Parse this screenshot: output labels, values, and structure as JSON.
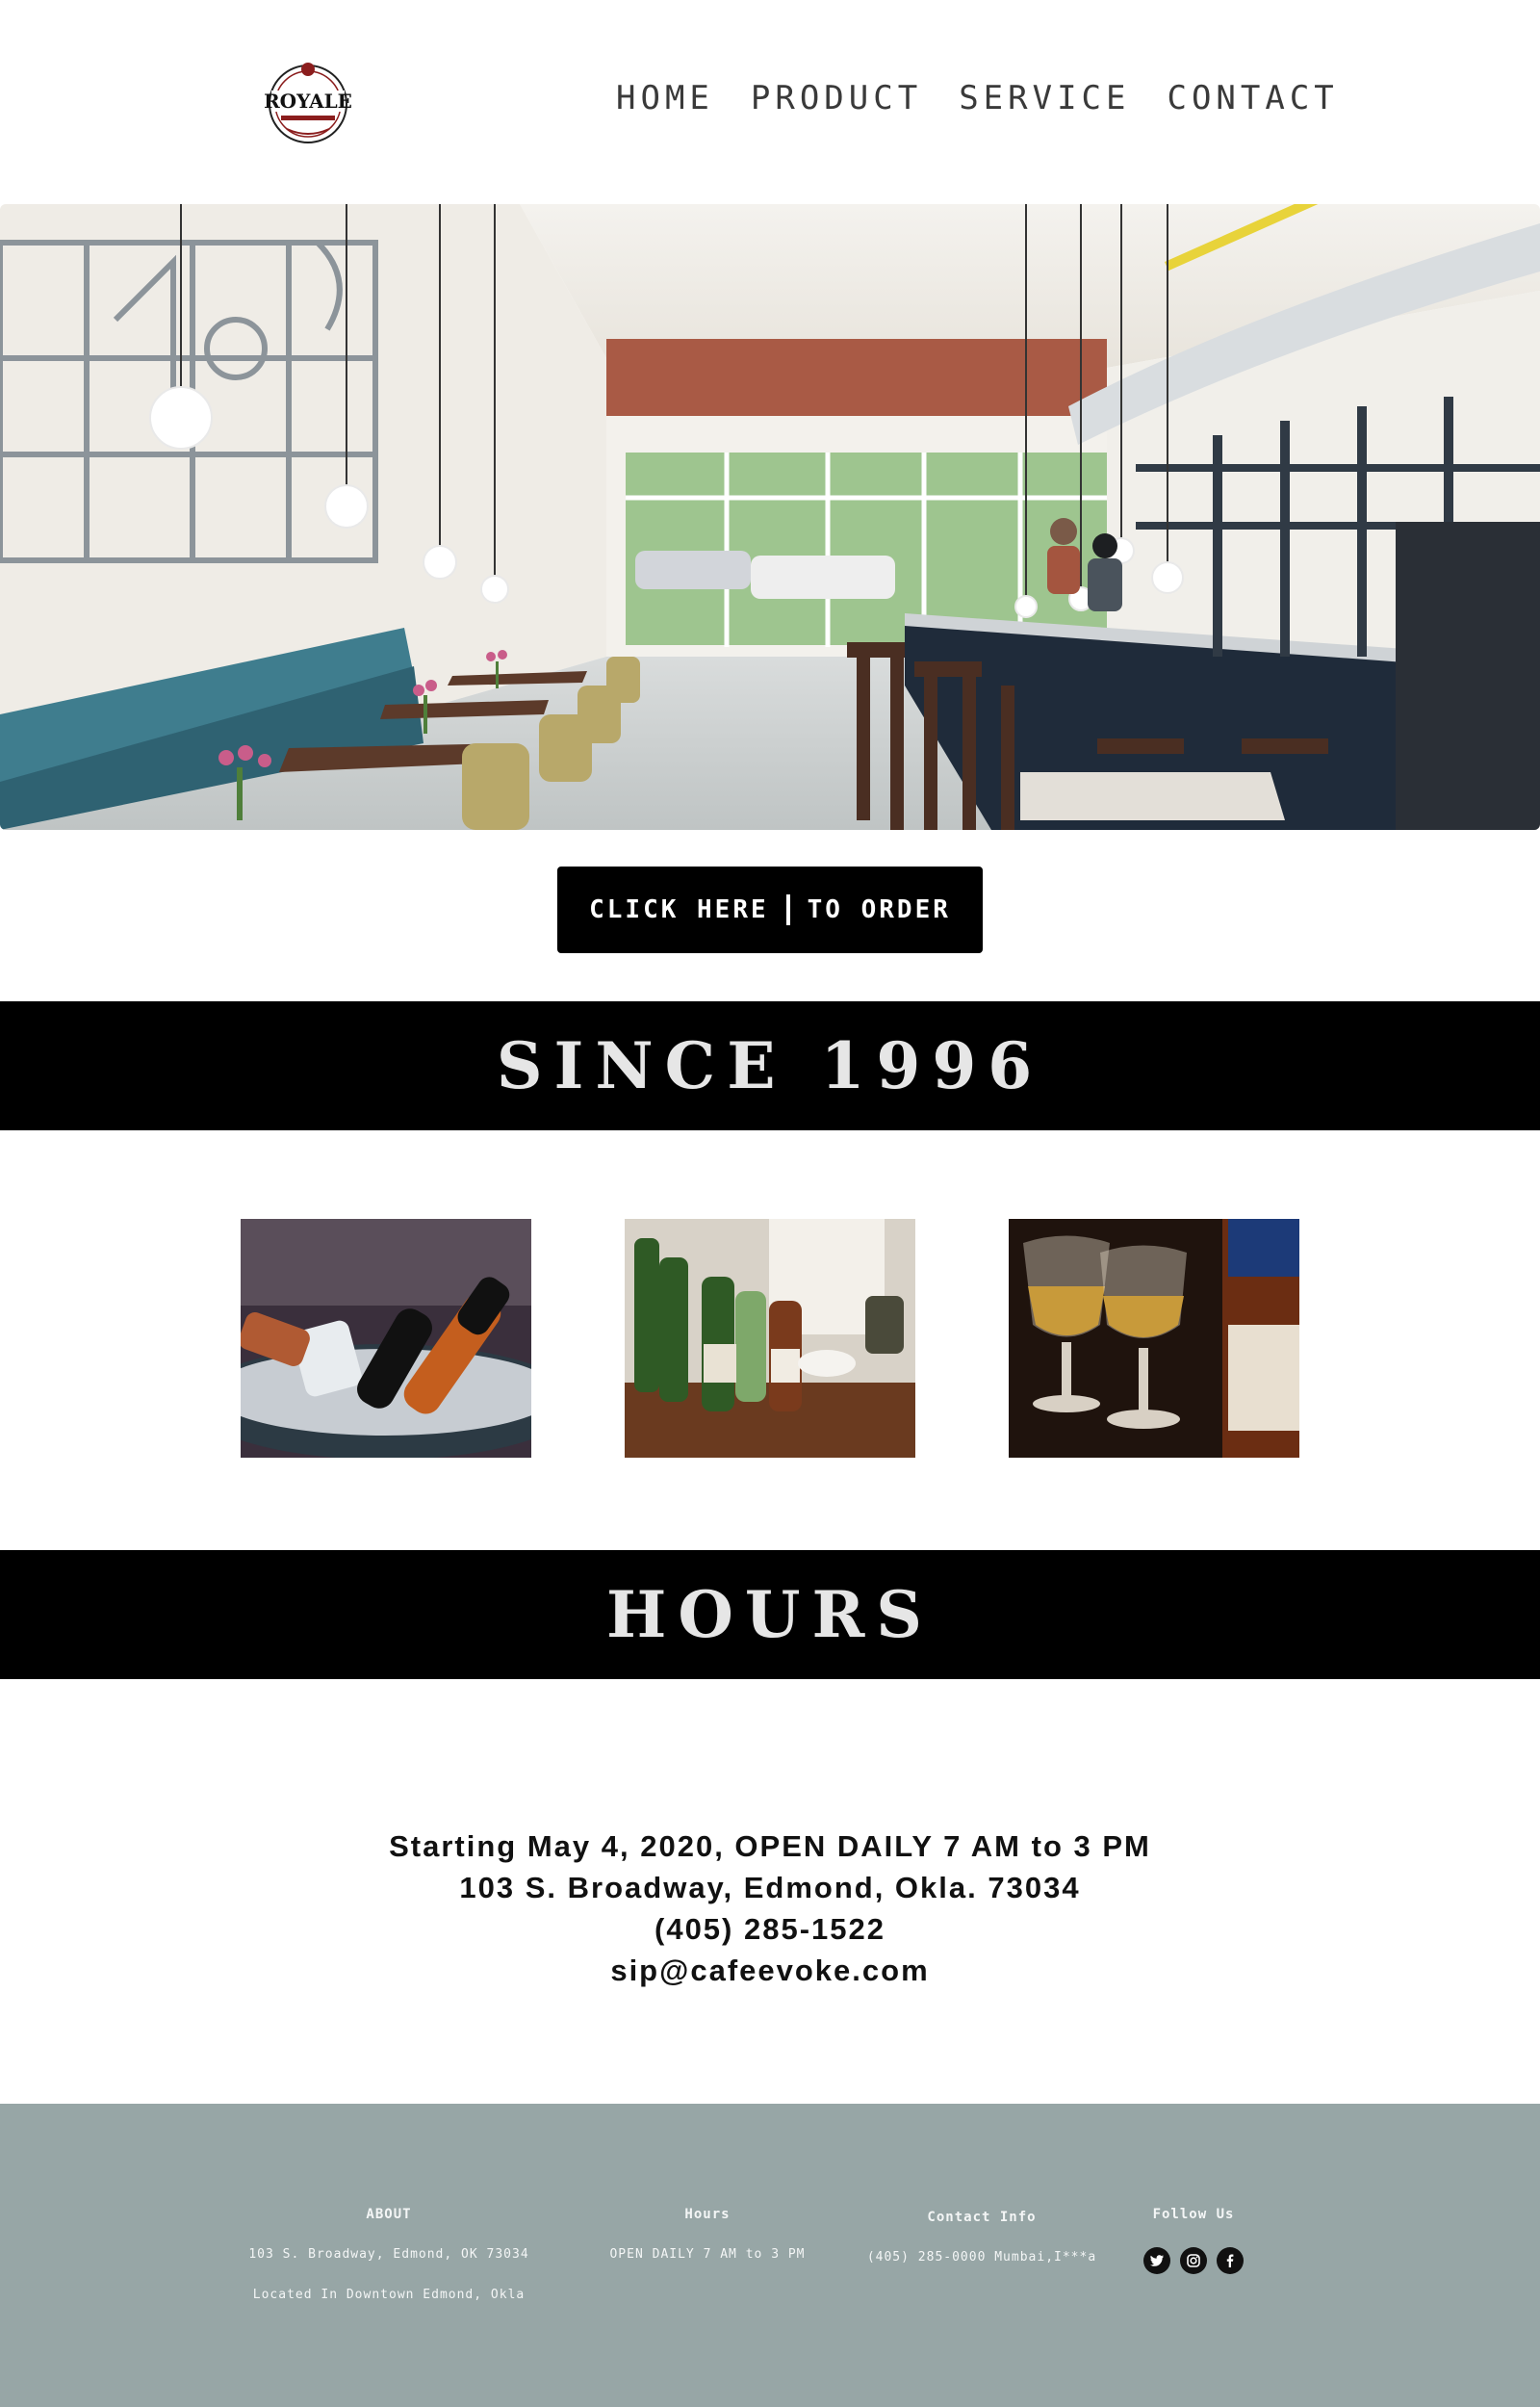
{
  "header": {
    "logo_text": "ROYALE",
    "nav": [
      "HOME",
      "PRODUCT",
      "SERVICE",
      "CONTACT"
    ]
  },
  "hero": {
    "order_button_left": "CLICK HERE",
    "order_button_right": "TO ORDER"
  },
  "since": {
    "title": "SINCE 1996"
  },
  "hours": {
    "title": "HOURS",
    "lines": [
      "Starting May 4, 2020, OPEN DAILY 7 AM to 3 PM",
      "103 S. Broadway, Edmond, Okla. 73034",
      "(405) 285-1522",
      "sip@cafeevoke.com"
    ]
  },
  "footer": {
    "about": {
      "title": "ABOUT",
      "lines": [
        "103 S. Broadway, Edmond, OK 73034",
        "Located In Downtown Edmond, Okla"
      ]
    },
    "hours": {
      "title": "Hours",
      "lines": [
        "OPEN DAILY 7 AM to 3 PM"
      ]
    },
    "contact": {
      "title": "Contact Info",
      "lines": [
        "(405) 285-0000 Mumbai,I***a"
      ]
    },
    "follow": {
      "title": "Follow Us",
      "icons": [
        "twitter-icon",
        "instagram-icon",
        "facebook-icon"
      ]
    }
  },
  "colors": {
    "band": "#000000",
    "footer_bg": "#97a6a6",
    "button": "#000000"
  }
}
